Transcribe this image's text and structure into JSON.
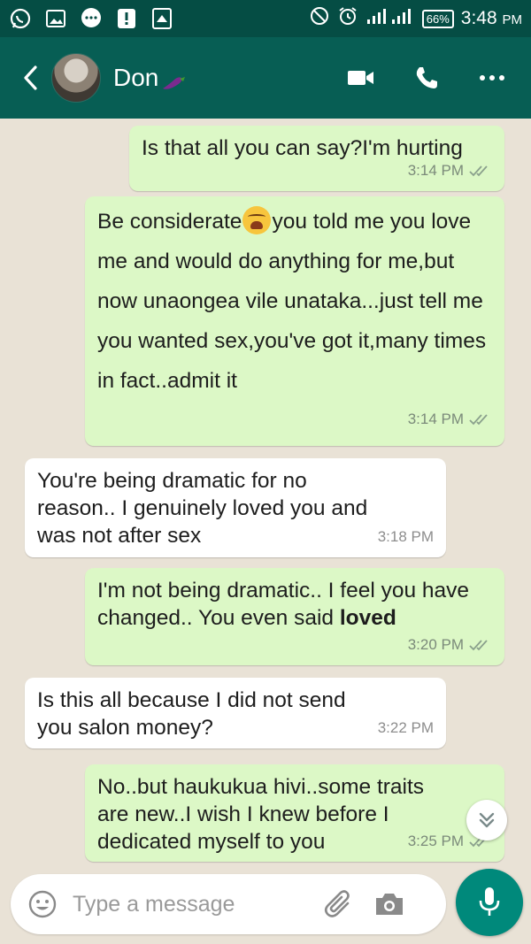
{
  "status_bar": {
    "battery": "66%",
    "time": "3:48",
    "time_suffix": "PM"
  },
  "header": {
    "contact_name": "Don"
  },
  "messages": [
    {
      "dir": "out",
      "text": "Is that all you can say?I'm hurting",
      "time": "3:14 PM"
    },
    {
      "dir": "out",
      "text_before_emoji": "Be considerate",
      "text_after_emoji": "you told me you love me and would do anything for me,but now unaongea vile unataka...just tell me you wanted sex,you've got it,many times in fact..admit it",
      "time": "3:14 PM"
    },
    {
      "dir": "in",
      "text": "You're being dramatic for no reason.. I genuinely loved you and was not after sex",
      "time": "3:18 PM"
    },
    {
      "dir": "out",
      "text_before_bold": "I'm not being dramatic.. I feel you have changed.. You even said ",
      "bold": "loved",
      "time": "3:20 PM"
    },
    {
      "dir": "in",
      "text": "Is this all because I did not send you salon money?",
      "time": "3:22 PM"
    },
    {
      "dir": "out",
      "text": "No..but haukukua hivi..some traits are new..I wish I knew before I dedicated myself to you",
      "time": "3:25 PM"
    }
  ],
  "composer": {
    "placeholder": "Type a message"
  },
  "colors": {
    "status_bar": "#054d44",
    "header": "#075e54",
    "outgoing_bubble": "#dcf8c6",
    "incoming_bubble": "#ffffff",
    "chat_background": "#e9e2d6",
    "mic_button": "#00897b"
  },
  "icons": [
    "whatsapp-icon",
    "gallery-icon",
    "chat-bubble-icon",
    "alert-icon",
    "upload-icon",
    "dnd-icon",
    "alarm-icon",
    "signal-icon",
    "back-arrow-icon",
    "eggplant-emoji",
    "video-call-icon",
    "phone-icon",
    "more-options-icon",
    "double-tick-icon",
    "weary-face-emoji",
    "chevron-double-down-icon",
    "emoji-icon",
    "paperclip-icon",
    "camera-icon",
    "mic-icon"
  ]
}
